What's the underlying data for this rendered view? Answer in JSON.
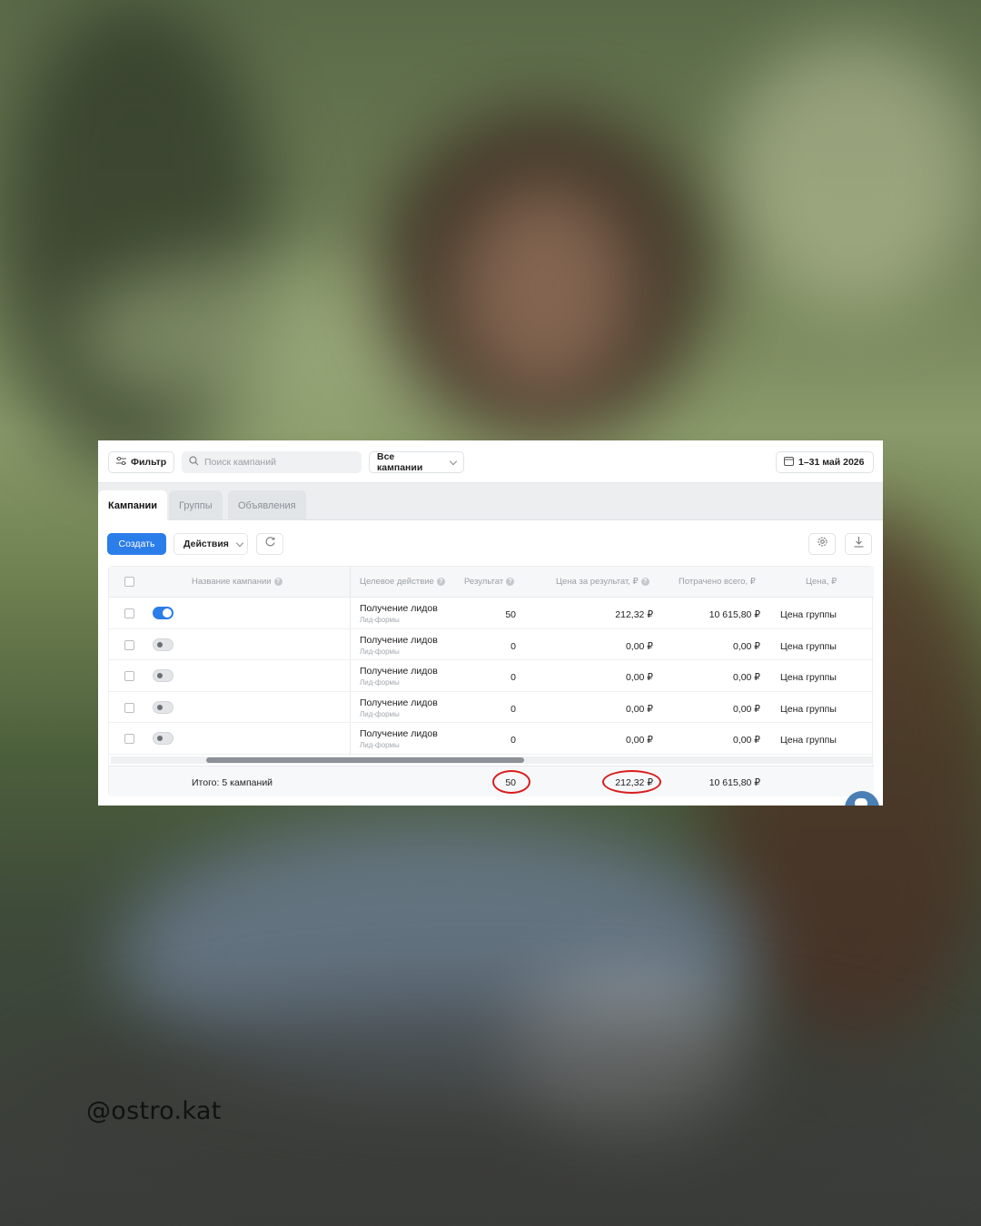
{
  "watermark": "@ostro.kat",
  "toolbar": {
    "filter_label": "Фильтр",
    "search_placeholder": "Поиск кампаний",
    "campaign_select": "Все кампании",
    "date_range": "1–31 май 2026"
  },
  "tabs": [
    {
      "label": "Кампании",
      "active": true
    },
    {
      "label": "Группы",
      "active": false
    },
    {
      "label": "Объявления",
      "active": false
    }
  ],
  "actions": {
    "create_label": "Создать",
    "actions_label": "Действия"
  },
  "table": {
    "columns": {
      "name": "Название кампании",
      "goal": "Целевое действие",
      "result": "Результат",
      "cost_per_result": "Цена за результат, ₽",
      "spent_total": "Потрачено всего, ₽",
      "price": "Цена, ₽"
    },
    "rows": [
      {
        "enabled": true,
        "goal": "Получение лидов",
        "goal_sub": "Лид-формы",
        "result": "50",
        "cost_per_result": "212,32 ₽",
        "spent": "10 615,80 ₽",
        "price": "Цена группы"
      },
      {
        "enabled": false,
        "goal": "Получение лидов",
        "goal_sub": "Лид-формы",
        "result": "0",
        "cost_per_result": "0,00 ₽",
        "spent": "0,00 ₽",
        "price": "Цена группы"
      },
      {
        "enabled": false,
        "goal": "Получение лидов",
        "goal_sub": "Лид-формы",
        "result": "0",
        "cost_per_result": "0,00 ₽",
        "spent": "0,00 ₽",
        "price": "Цена группы"
      },
      {
        "enabled": false,
        "goal": "Получение лидов",
        "goal_sub": "Лид-формы",
        "result": "0",
        "cost_per_result": "0,00 ₽",
        "spent": "0,00 ₽",
        "price": "Цена группы"
      },
      {
        "enabled": false,
        "goal": "Получение лидов",
        "goal_sub": "Лид-формы",
        "result": "0",
        "cost_per_result": "0,00 ₽",
        "spent": "0,00 ₽",
        "price": "Цена группы"
      }
    ],
    "totals": {
      "label": "Итого: 5 кампаний",
      "result": "50",
      "cost_per_result": "212,32 ₽",
      "spent": "10 615,80 ₽"
    }
  },
  "colors": {
    "accent": "#2b7de9",
    "highlight_circle": "#d81e1e"
  }
}
